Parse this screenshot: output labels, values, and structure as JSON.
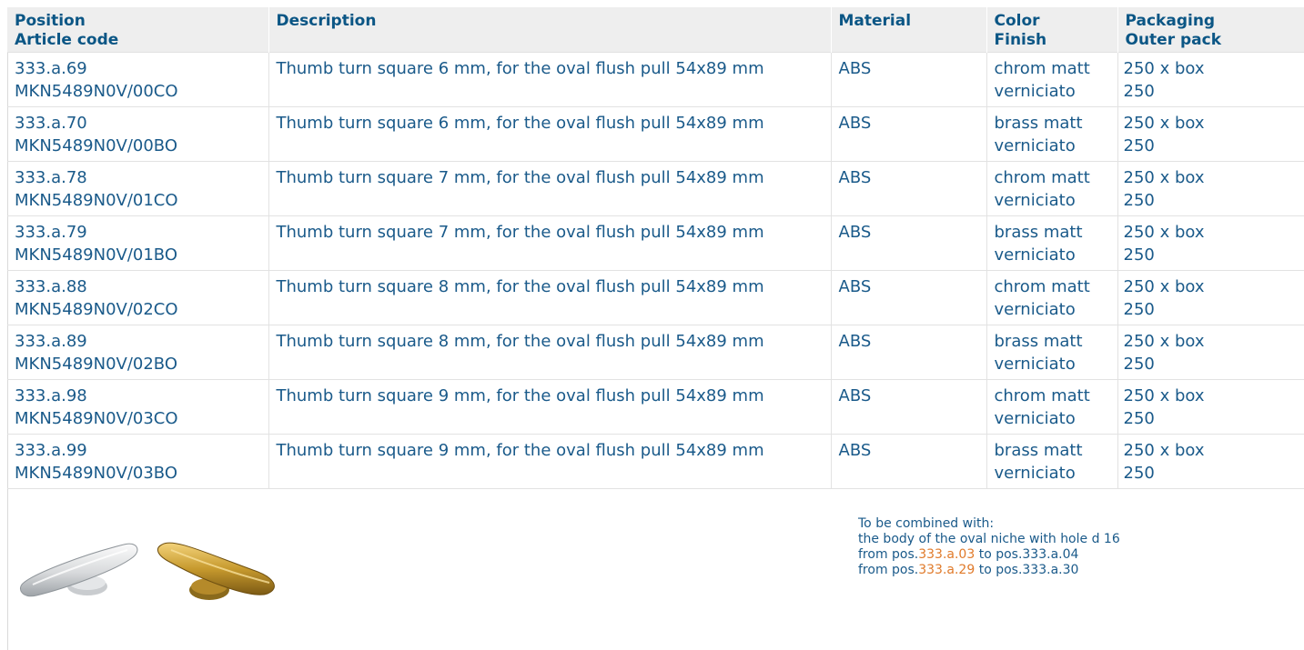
{
  "table": {
    "headers": [
      [
        "Position",
        "Article code"
      ],
      [
        "Description"
      ],
      [
        "Material"
      ],
      [
        "Color",
        "Finish"
      ],
      [
        "Packaging",
        "Outer pack"
      ]
    ],
    "rows": [
      {
        "position": "333.a.69",
        "article_code": "MKN5489N0V/00CO",
        "description": "Thumb turn square 6 mm, for the oval flush pull 54x89 mm",
        "material": "ABS",
        "color": "chrom matt",
        "finish": "verniciato",
        "packaging": "250 x box",
        "outer_pack": "250"
      },
      {
        "position": "333.a.70",
        "article_code": "MKN5489N0V/00BO",
        "description": "Thumb turn square 6 mm, for the oval flush pull 54x89 mm",
        "material": "ABS",
        "color": "brass matt",
        "finish": "verniciato",
        "packaging": "250 x box",
        "outer_pack": "250"
      },
      {
        "position": "333.a.78",
        "article_code": "MKN5489N0V/01CO",
        "description": "Thumb turn square 7 mm, for the oval flush pull 54x89 mm",
        "material": "ABS",
        "color": "chrom matt",
        "finish": "verniciato",
        "packaging": "250 x box",
        "outer_pack": "250"
      },
      {
        "position": "333.a.79",
        "article_code": "MKN5489N0V/01BO",
        "description": "Thumb turn square 7 mm, for the oval flush pull 54x89 mm",
        "material": "ABS",
        "color": "brass matt",
        "finish": "verniciato",
        "packaging": "250 x box",
        "outer_pack": "250"
      },
      {
        "position": "333.a.88",
        "article_code": "MKN5489N0V/02CO",
        "description": "Thumb turn square 8 mm, for the oval flush pull 54x89 mm",
        "material": "ABS",
        "color": "chrom matt",
        "finish": "verniciato",
        "packaging": "250 x box",
        "outer_pack": "250"
      },
      {
        "position": "333.a.89",
        "article_code": "MKN5489N0V/02BO",
        "description": "Thumb turn square 8 mm, for the oval flush pull 54x89 mm",
        "material": "ABS",
        "color": "brass matt",
        "finish": "verniciato",
        "packaging": "250 x box",
        "outer_pack": "250"
      },
      {
        "position": "333.a.98",
        "article_code": "MKN5489N0V/03CO",
        "description": "Thumb turn square 9 mm, for the oval flush pull 54x89 mm",
        "material": "ABS",
        "color": "chrom matt",
        "finish": "verniciato",
        "packaging": "250 x box",
        "outer_pack": "250"
      },
      {
        "position": "333.a.99",
        "article_code": "MKN5489N0V/03BO",
        "description": "Thumb turn square 9 mm, for the oval flush pull 54x89 mm",
        "material": "ABS",
        "color": "brass matt",
        "finish": "verniciato",
        "packaging": "250 x box",
        "outer_pack": "250"
      }
    ]
  },
  "notes": {
    "intro": "To be combined with:",
    "body_line": "the body of the oval niche with hole d 16",
    "ranges": [
      {
        "from_prefix": "from pos.",
        "from_link": "333.a.03",
        "to_text": " to pos.333.a.04"
      },
      {
        "from_prefix": "from pos.",
        "from_link": "333.a.29",
        "to_text": " to pos.333.a.30"
      }
    ]
  },
  "products": [
    {
      "name": "chrome-matt-thumb-turn-icon"
    },
    {
      "name": "brass-matt-thumb-turn-icon"
    }
  ],
  "colors": {
    "text": "#1a5a8a",
    "header_text": "#0b5685",
    "header_bg": "#eeeeee",
    "link": "#e07a2a",
    "grid": "#e2e2e2"
  }
}
